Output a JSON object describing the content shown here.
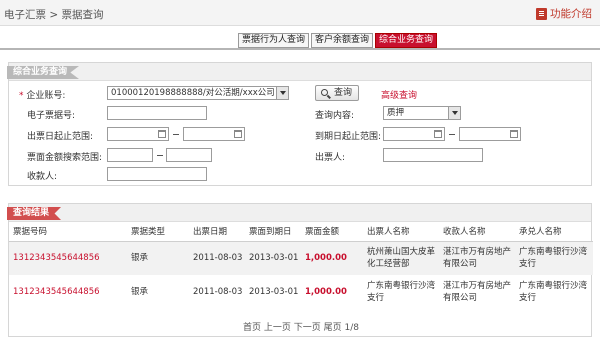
{
  "header": {
    "breadcrumb": "电子汇票 > 票据查询",
    "help_label": "功能介绍"
  },
  "tabs": [
    {
      "label": "票据行为人查询",
      "active": false
    },
    {
      "label": "客户余额查询",
      "active": false
    },
    {
      "label": "综合业务查询",
      "active": true
    }
  ],
  "form": {
    "section_title": "综合业务查询",
    "account_label": "企业账号:",
    "account_value": "01000120198888888/对公活期/xxx公司",
    "query_button": "查询",
    "advanced_link": "高级查询",
    "bill_no_label": "电子票据号:",
    "bill_no_value": "",
    "content_label": "查询内容:",
    "content_value": "质押",
    "issue_range_label": "出票日起止范围:",
    "due_range_label": "到期日起止范围:",
    "amount_range_label": "票面金额搜索范围:",
    "drawer_label": "出票人:",
    "payee_label": "收款人:"
  },
  "results": {
    "section_title": "查询结果",
    "columns": [
      "票据号码",
      "票据类型",
      "出票日期",
      "票面到期日",
      "票面金额",
      "出票人名称",
      "收款人名称",
      "承兑人名称"
    ],
    "rows": [
      [
        "1312343545644856",
        "银承",
        "2011-08-03",
        "2013-03-01",
        "1,000.00",
        "杭州萧山国大皮革化工经营部",
        "湛江市万有房地产有限公司",
        "广东南粤银行沙湾支行"
      ],
      [
        "1312343545644856",
        "银承",
        "2011-08-03",
        "2013-03-01",
        "1,000.00",
        "广东南粤银行沙湾支行",
        "湛江市万有房地产有限公司",
        "广东南粤银行沙湾支行"
      ]
    ],
    "pager": "首页 上一页 下一页 尾页 1/8"
  },
  "colors": {
    "accent": "#c8102e"
  }
}
